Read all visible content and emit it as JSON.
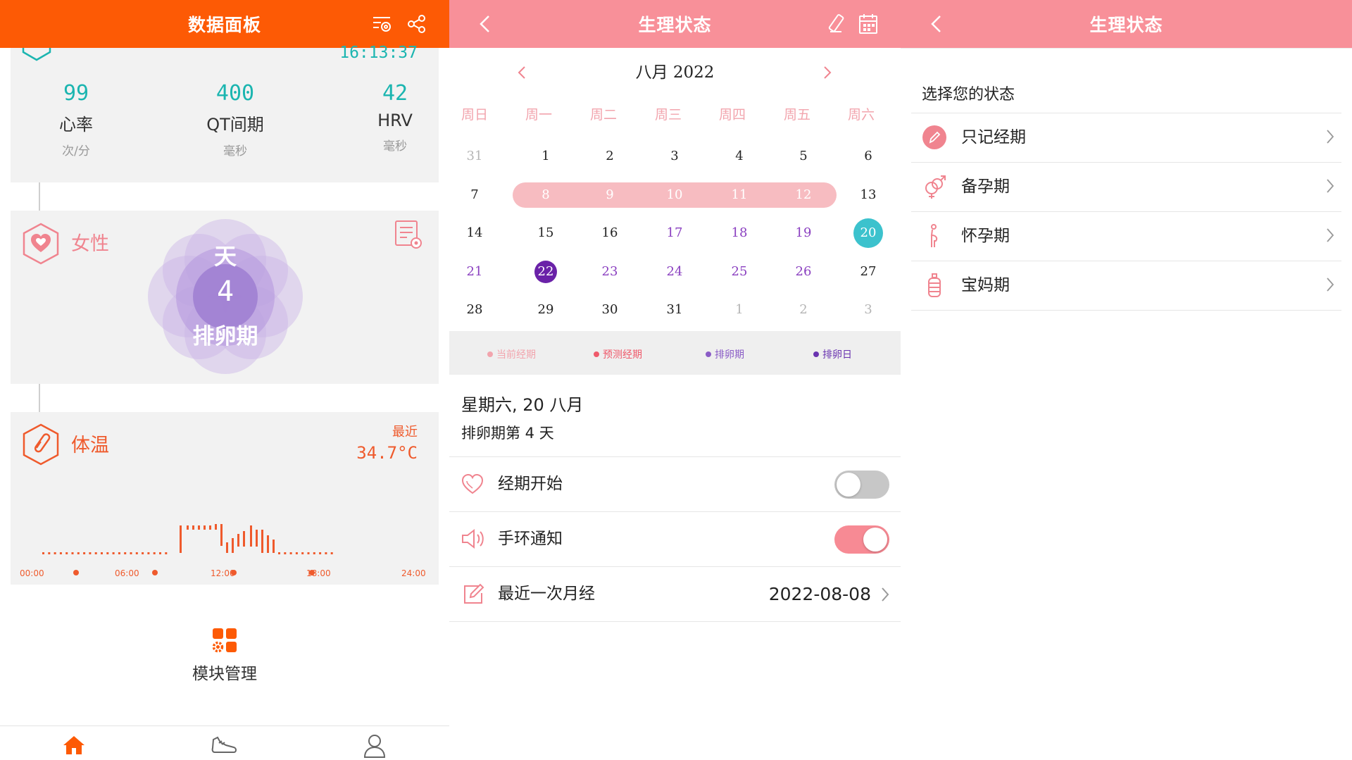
{
  "dashboard": {
    "title": "数据面板",
    "time": "16:13:37",
    "metrics": [
      {
        "value": "99",
        "name": "心率",
        "unit": "次/分"
      },
      {
        "value": "400",
        "name": "QT间期",
        "unit": "毫秒"
      },
      {
        "value": "42",
        "name": "HRV",
        "unit": "毫秒"
      }
    ],
    "female": {
      "label": "女性",
      "top": "天",
      "num": "4",
      "phase": "排卵期"
    },
    "temperature": {
      "label": "体温",
      "recent_label": "最近",
      "recent_value": "34.7°C",
      "ticks": [
        "00:00",
        "06:00",
        "12:00",
        "18:00",
        "24:00"
      ]
    },
    "module_label": "模块管理"
  },
  "calendar_screen": {
    "title": "生理状态",
    "month_label": "八月 2022",
    "weekdays": [
      "周日",
      "周一",
      "周二",
      "周三",
      "周四",
      "周五",
      "周六"
    ],
    "weeks": [
      [
        "31",
        "1",
        "2",
        "3",
        "4",
        "5",
        "6"
      ],
      [
        "7",
        "8",
        "9",
        "10",
        "11",
        "12",
        "13"
      ],
      [
        "14",
        "15",
        "16",
        "17",
        "18",
        "19",
        "20"
      ],
      [
        "21",
        "22",
        "23",
        "24",
        "25",
        "26",
        "27"
      ],
      [
        "28",
        "29",
        "30",
        "31",
        "1",
        "2",
        "3"
      ]
    ],
    "legend": [
      "当前经期",
      "预测经期",
      "排卵期",
      "排卵日"
    ],
    "selected_date": "星期六, 20 八月",
    "selected_info": "排卵期第 4 天",
    "rows": {
      "period_start": "经期开始",
      "band_notify": "手环通知",
      "last_period": "最近一次月经",
      "last_period_value": "2022-08-08"
    },
    "toggles": {
      "period_start": false,
      "band_notify": true
    }
  },
  "status_screen": {
    "title": "生理状态",
    "prompt": "选择您的状态",
    "options": [
      "只记经期",
      "备孕期",
      "怀孕期",
      "宝妈期"
    ]
  },
  "colors": {
    "orange": "#fd5a05",
    "pink": "#f89099",
    "teal": "#1bb5b0",
    "purple": "#8a3fc0",
    "period_bar": "#f7bcc1"
  }
}
